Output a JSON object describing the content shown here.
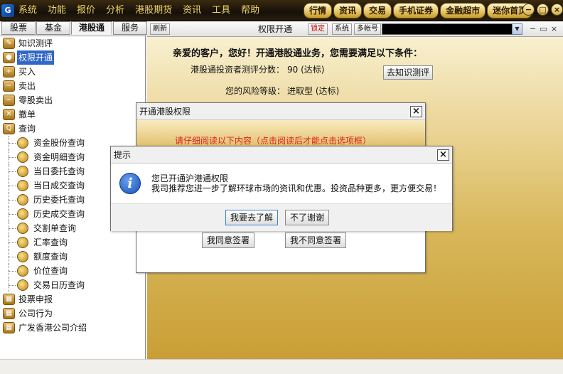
{
  "menu": [
    "系统",
    "功能",
    "报价",
    "分析",
    "港股期货",
    "资讯",
    "工具",
    "帮助"
  ],
  "quick_buttons": [
    "行情",
    "资讯",
    "交易",
    "手机证券",
    "金融超市",
    "迷你首页"
  ],
  "window_controls": [
    "−",
    "□",
    "×"
  ],
  "left_tabs": [
    "股票",
    "基金",
    "港股通",
    "服务"
  ],
  "tree": [
    {
      "label": "知识测评",
      "icon": "exam-icon",
      "level": 0
    },
    {
      "label": "权限开通",
      "icon": "user-icon",
      "level": 0,
      "selected": true
    },
    {
      "label": "买入",
      "icon": "buy-icon",
      "level": 0
    },
    {
      "label": "卖出",
      "icon": "sell-icon",
      "level": 0
    },
    {
      "label": "零股卖出",
      "icon": "odd-lot-sell-icon",
      "level": 0
    },
    {
      "label": "撤单",
      "icon": "cancel-order-icon",
      "level": 0
    },
    {
      "label": "查询",
      "icon": "query-icon",
      "level": 0
    },
    {
      "label": "资金股份查询",
      "icon": "query-icon",
      "level": 1
    },
    {
      "label": "资金明细查询",
      "icon": "query-icon",
      "level": 1
    },
    {
      "label": "当日委托查询",
      "icon": "query-icon",
      "level": 1
    },
    {
      "label": "当日成交查询",
      "icon": "query-icon",
      "level": 1
    },
    {
      "label": "历史委托查询",
      "icon": "query-icon",
      "level": 1
    },
    {
      "label": "历史成交查询",
      "icon": "query-icon",
      "level": 1
    },
    {
      "label": "交割单查询",
      "icon": "query-icon",
      "level": 1
    },
    {
      "label": "汇率查询",
      "icon": "query-icon",
      "level": 1
    },
    {
      "label": "额度查询",
      "icon": "query-icon",
      "level": 1
    },
    {
      "label": "价位查询",
      "icon": "query-icon",
      "level": 1
    },
    {
      "label": "交易日历查询",
      "icon": "query-icon",
      "level": 1
    },
    {
      "label": "投票申报",
      "icon": "grid-icon",
      "level": 0
    },
    {
      "label": "公司行为",
      "icon": "grid-icon",
      "level": 0
    },
    {
      "label": "广发香港公司介绍",
      "icon": "grid-icon",
      "level": 0
    }
  ],
  "toolbar": {
    "refresh_label": "刷新",
    "title": "权限开通",
    "lock_label": "锁定",
    "system_label": "系统",
    "multi_account_label": "多帐号"
  },
  "content": {
    "greeting": "亲爱的客户，您好！开通港股通业务，您需要满足以下条件：",
    "score_label": "港股通投资者测评分数：",
    "score_value": "90 (达标)",
    "risk_label": "您的风险等级：",
    "risk_value": "进取型 (达标)",
    "test_button": "去知识测评"
  },
  "dialog1": {
    "title": "开通港股权限",
    "notice": "请仔细阅读以下内容（点击阅读后才能点击选项框）",
    "agree_button": "我同意签署",
    "disagree_button": "我不同意签署"
  },
  "dialog2": {
    "title": "提示",
    "line1": "您已开通沪港通权限",
    "line2": "我司推荐您进一步了解环球市场的资讯和优惠。投资品种更多，更方便交易！",
    "yes_button": "我要去了解",
    "no_button": "不了谢谢"
  }
}
